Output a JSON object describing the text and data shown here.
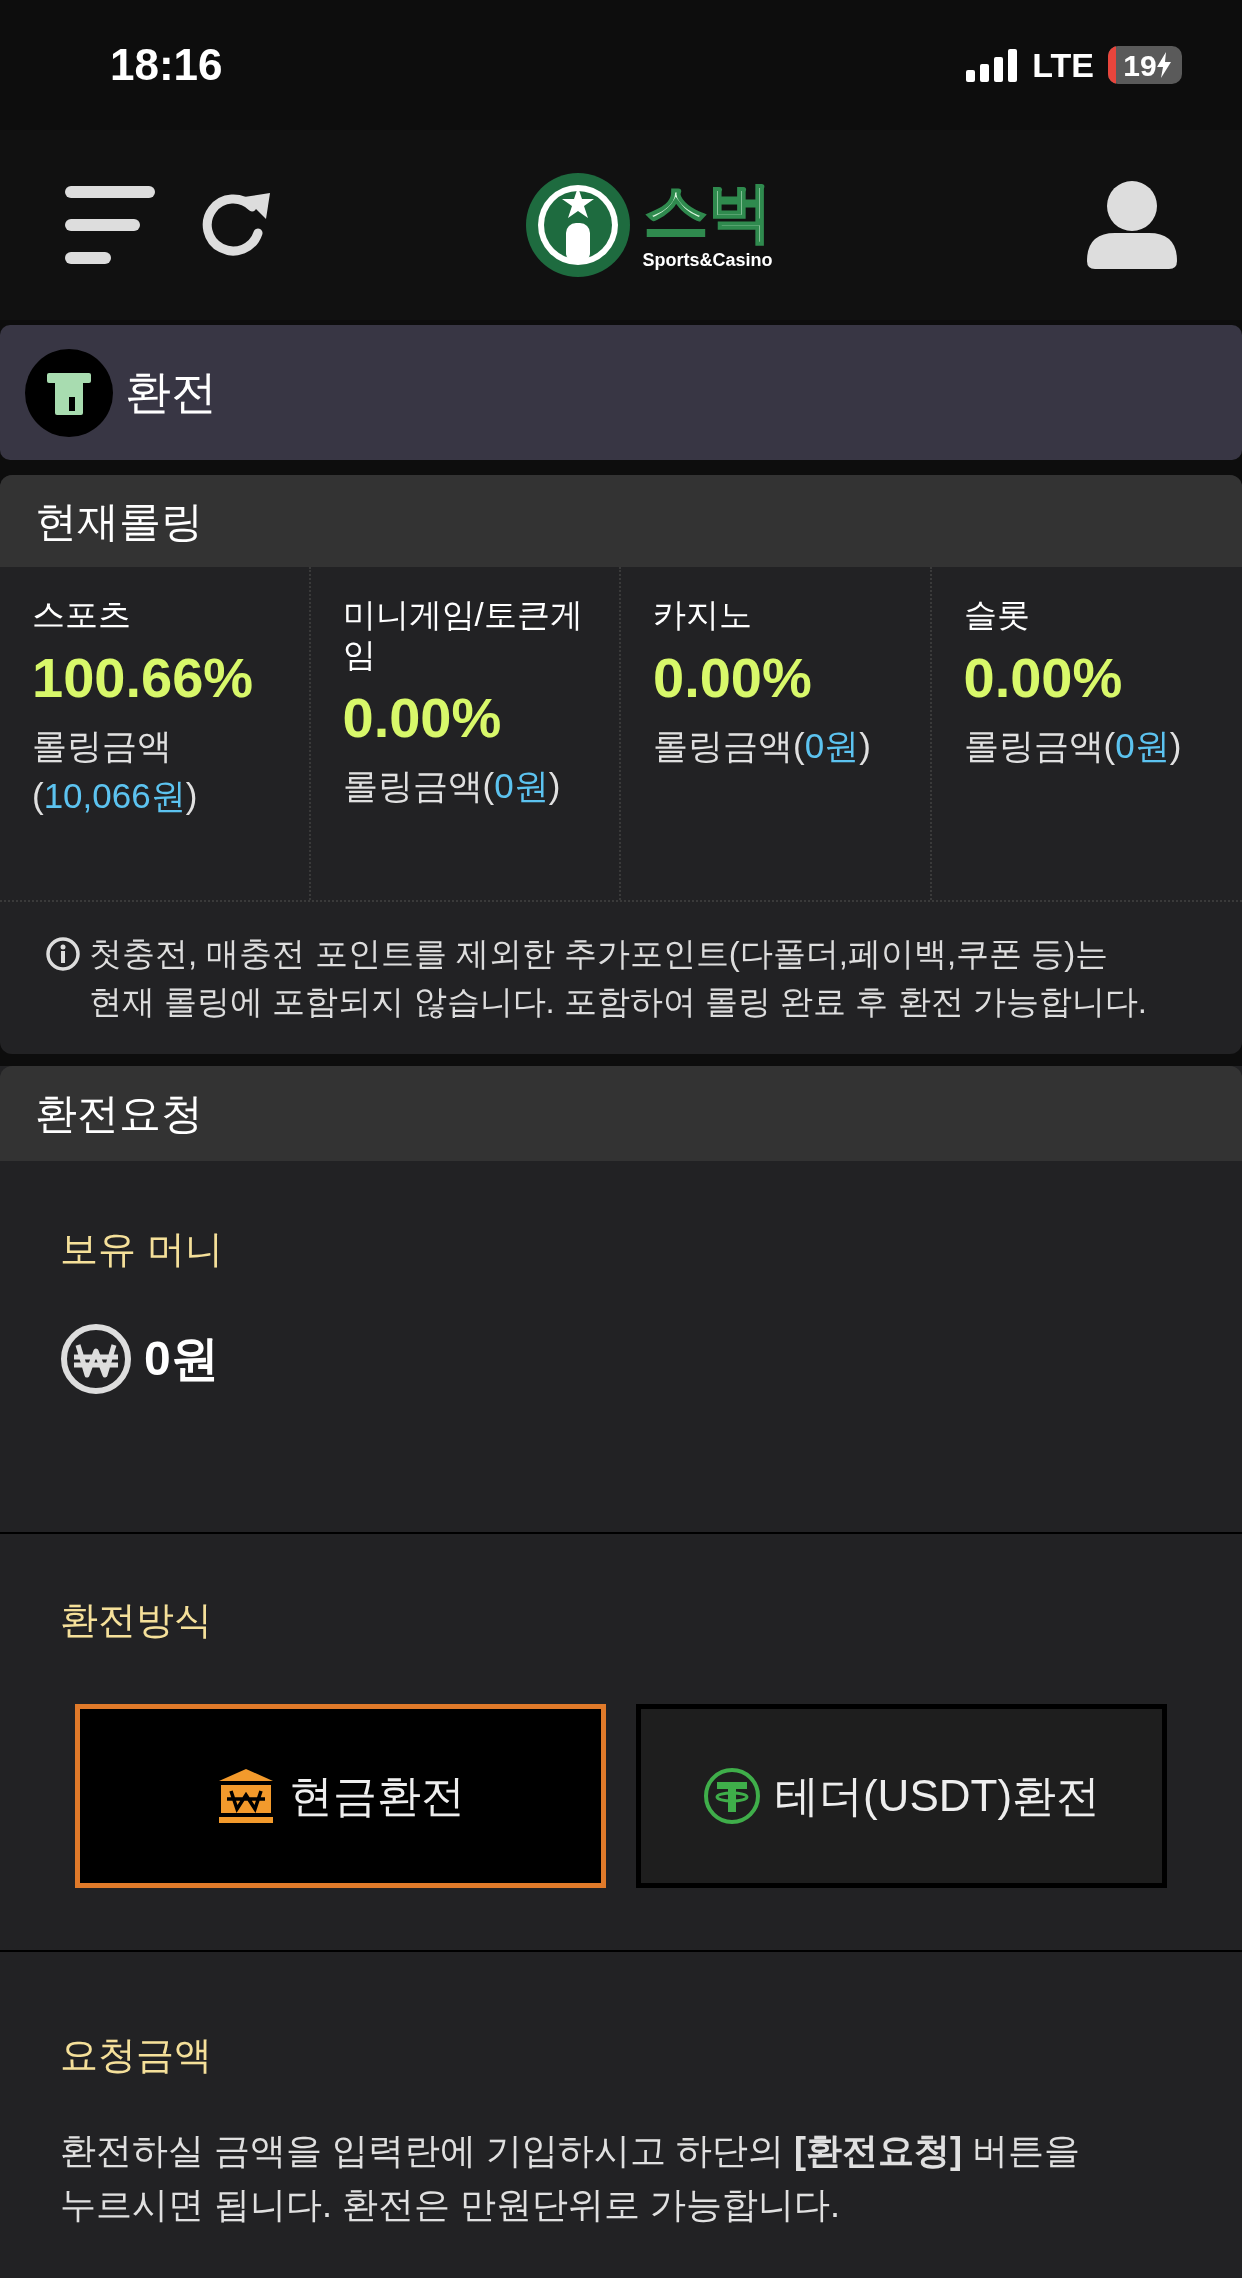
{
  "status_bar": {
    "time": "18:16",
    "network": "LTE",
    "battery": "19"
  },
  "header": {
    "brand": "스벅",
    "tagline": "Sports&Casino"
  },
  "page_title": "환전",
  "rolling": {
    "title": "현재롤링",
    "items": [
      {
        "name": "스포츠",
        "percent": "100.66%",
        "amount_open": "롤링금액(",
        "amount": "10,066원",
        "amount_close": ")"
      },
      {
        "name": "미니게임/토큰게임",
        "percent": "0.00%",
        "amount_open": "롤링금액(",
        "amount": "0원",
        "amount_close": ")"
      },
      {
        "name": "카지노",
        "percent": "0.00%",
        "amount_open": "롤링금액(",
        "amount": "0원",
        "amount_close": ")"
      },
      {
        "name": "슬롯",
        "percent": "0.00%",
        "amount_open": "롤링금액(",
        "amount": "0원",
        "amount_close": ")"
      }
    ],
    "note": "첫충전, 매충전 포인트를 제외한 추가포인트(다폴더,페이백,쿠폰 등)는 현재 롤링에 포함되지 않습니다. 포함하여 롤링 완료 후 환전 가능합니다."
  },
  "request": {
    "title": "환전요청",
    "balance_label": "보유 머니",
    "balance": "0원",
    "method_label": "환전방식",
    "methods": [
      {
        "kind": "cash",
        "label": "현금환전",
        "selected": true
      },
      {
        "kind": "tether",
        "label": "테더(USDT)환전",
        "selected": false
      }
    ],
    "amount_label": "요청금액",
    "instructions": "환전하실 금액을 입력란에 기입하시고 하단의 **[환전요청]** 버튼을 누르시면 됩니다. 환전은 만원단위로 가능합니다."
  }
}
